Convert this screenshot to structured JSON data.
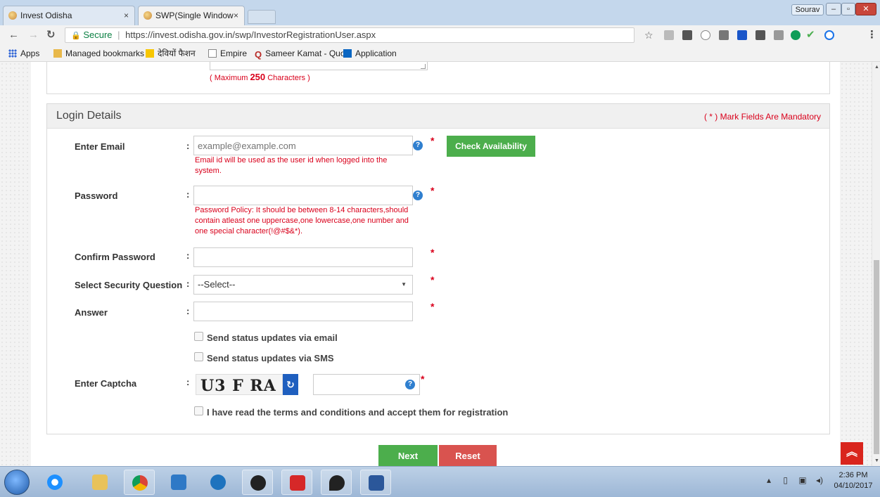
{
  "browser": {
    "tabs": [
      {
        "title": "Invest Odisha",
        "close": "×"
      },
      {
        "title": "SWP(Single Window Port",
        "close": "×"
      }
    ],
    "profile_name": "Sourav",
    "security_label": "Secure",
    "url": "https://invest.odisha.gov.in/swp/InvestorRegistrationUser.aspx",
    "bookmarks": [
      {
        "label": "Apps",
        "icon": "apps-grid-icon",
        "color": "#3367d6"
      },
      {
        "label": "Managed bookmarks",
        "icon": "folder-icon",
        "color": "#e8b84a"
      },
      {
        "label": "देवियों फैशन",
        "icon": "flipkart-icon",
        "color": "#f7c600"
      },
      {
        "label": "Empire",
        "icon": "page-icon",
        "color": "#888888"
      },
      {
        "label": "Sameer Kamat - Quo",
        "icon": "quora-icon",
        "color": "#b92b27"
      },
      {
        "label": "Application",
        "icon": "linkedin-icon",
        "color": "#0a66c2"
      }
    ]
  },
  "page": {
    "prev_section": {
      "max_chars_prefix": "( Maximum ",
      "max_chars_value": "250",
      "max_chars_suffix": " Characters )"
    },
    "login_details": {
      "title": "Login Details",
      "mandatory_note": "( * ) Mark Fields Are Mandatory",
      "required_mark": "*",
      "colon": ":",
      "email": {
        "label": "Enter Email",
        "placeholder": "example@example.com",
        "hint": "Email id will be used as the user id when logged into the system.",
        "check_button": "Check Availability"
      },
      "password": {
        "label": "Password",
        "hint": "Password Policy: It should be between 8-14 characters,should contain atleast one uppercase,one lowercase,one number and one special character(!@#$&*)."
      },
      "confirm_password": {
        "label": "Confirm Password"
      },
      "security_question": {
        "label": "Select Security Question",
        "selected": "--Select--"
      },
      "answer": {
        "label": "Answer"
      },
      "notify_email": {
        "label": "Send status updates via email",
        "checked": false
      },
      "notify_sms": {
        "label": "Send status updates via SMS",
        "checked": false
      },
      "captcha": {
        "label": "Enter Captcha",
        "image_text": "U3 F RA"
      },
      "terms": {
        "label": "I have read the terms and conditions and accept them for registration",
        "checked": false
      }
    },
    "buttons": {
      "next": "Next",
      "reset": "Reset"
    },
    "colors": {
      "required": "#d9001b",
      "green": "#4cae4c",
      "red": "#d9534f",
      "help": "#2f7fcf"
    }
  },
  "taskbar": {
    "time": "2:36 PM",
    "date": "04/10/2017",
    "apps": [
      "internet-explorer-icon",
      "file-explorer-icon",
      "chrome-icon",
      "media-icon",
      "contacts-icon",
      "pdf-reader-icon",
      "acrobat-icon",
      "location-icon",
      "word-icon"
    ]
  }
}
